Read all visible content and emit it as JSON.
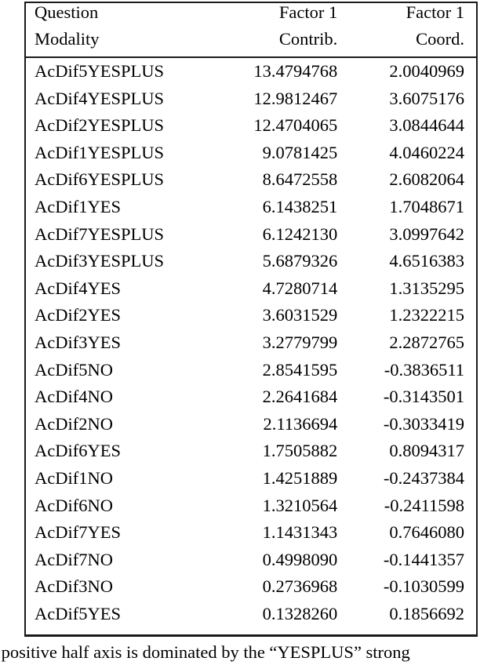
{
  "table": {
    "columns": [
      {
        "key": "question_modality",
        "header_line1": "Question",
        "header_line2": "Modality",
        "align": "left"
      },
      {
        "key": "factor1_contrib",
        "header_line1": "Factor 1",
        "header_line2": "Contrib.",
        "align": "right"
      },
      {
        "key": "factor1_coord",
        "header_line1": "Factor 1",
        "header_line2": "Coord.",
        "align": "right"
      }
    ],
    "rows": [
      {
        "question_modality": "AcDif5YESPLUS",
        "factor1_contrib": "13.4794768",
        "factor1_coord": "2.0040969"
      },
      {
        "question_modality": "AcDif4YESPLUS",
        "factor1_contrib": "12.9812467",
        "factor1_coord": "3.6075176"
      },
      {
        "question_modality": "AcDif2YESPLUS",
        "factor1_contrib": "12.4704065",
        "factor1_coord": "3.0844644"
      },
      {
        "question_modality": "AcDif1YESPLUS",
        "factor1_contrib": "9.0781425",
        "factor1_coord": "4.0460224"
      },
      {
        "question_modality": "AcDif6YESPLUS",
        "factor1_contrib": "8.6472558",
        "factor1_coord": "2.6082064"
      },
      {
        "question_modality": "AcDif1YES",
        "factor1_contrib": "6.1438251",
        "factor1_coord": "1.7048671"
      },
      {
        "question_modality": "AcDif7YESPLUS",
        "factor1_contrib": "6.1242130",
        "factor1_coord": "3.0997642"
      },
      {
        "question_modality": "AcDif3YESPLUS",
        "factor1_contrib": "5.6879326",
        "factor1_coord": "4.6516383"
      },
      {
        "question_modality": "AcDif4YES",
        "factor1_contrib": "4.7280714",
        "factor1_coord": "1.3135295"
      },
      {
        "question_modality": "AcDif2YES",
        "factor1_contrib": "3.6031529",
        "factor1_coord": "1.2322215"
      },
      {
        "question_modality": "AcDif3YES",
        "factor1_contrib": "3.2779799",
        "factor1_coord": "2.2872765"
      },
      {
        "question_modality": "AcDif5NO",
        "factor1_contrib": "2.8541595",
        "factor1_coord": "-0.3836511"
      },
      {
        "question_modality": "AcDif4NO",
        "factor1_contrib": "2.2641684",
        "factor1_coord": "-0.3143501"
      },
      {
        "question_modality": "AcDif2NO",
        "factor1_contrib": "2.1136694",
        "factor1_coord": "-0.3033419"
      },
      {
        "question_modality": "AcDif6YES",
        "factor1_contrib": "1.7505882",
        "factor1_coord": "0.8094317"
      },
      {
        "question_modality": "AcDif1NO",
        "factor1_contrib": "1.4251889",
        "factor1_coord": "-0.2437384"
      },
      {
        "question_modality": "AcDif6NO",
        "factor1_contrib": "1.3210564",
        "factor1_coord": "-0.2411598"
      },
      {
        "question_modality": "AcDif7YES",
        "factor1_contrib": "1.1431343",
        "factor1_coord": "0.7646080"
      },
      {
        "question_modality": "AcDif7NO",
        "factor1_contrib": "0.4998090",
        "factor1_coord": "-0.1441357"
      },
      {
        "question_modality": "AcDif3NO",
        "factor1_contrib": "0.2736968",
        "factor1_coord": "-0.1030599"
      },
      {
        "question_modality": "AcDif5YES",
        "factor1_contrib": "0.1328260",
        "factor1_coord": "0.1856692"
      }
    ]
  },
  "caption": {
    "clipped_line": "e positive half axis is dominated by the “YESPLUS”  strong"
  },
  "colors": {
    "rule": "#1a1a1a",
    "text": "#000000",
    "background": "#ffffff"
  }
}
